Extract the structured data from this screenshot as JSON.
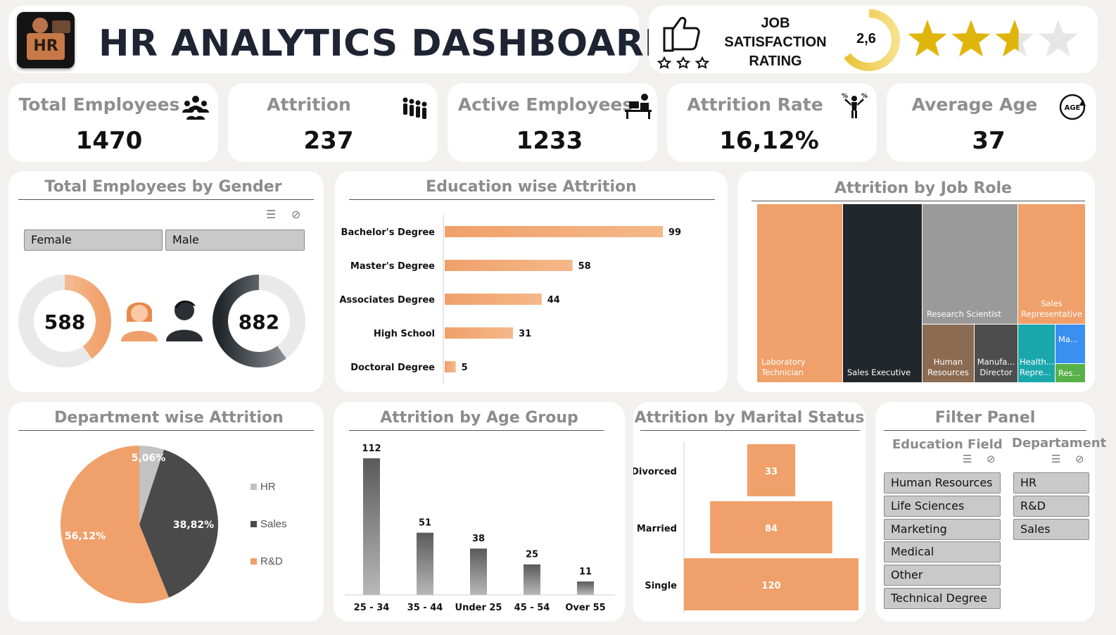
{
  "header": {
    "title": "HR ANALYTICS DASHBOARD",
    "logo_text": "HR"
  },
  "job_satisfaction": {
    "label_lines": [
      "JOB",
      "SATISFACTION",
      "RATING"
    ],
    "value": "2,6",
    "rating": 2.6,
    "max": 4,
    "gauge_fraction": 0.65,
    "star_color": "#e0b50b",
    "empty_star_color": "#e6e6e6"
  },
  "kpis": [
    {
      "label": "Total Employees",
      "value": "1470",
      "icon": "people-group-icon"
    },
    {
      "label": "Attrition",
      "value": "237",
      "icon": "people-leaving-icon"
    },
    {
      "label": "Active Employees",
      "value": "1233",
      "icon": "employee-at-desk-icon"
    },
    {
      "label": "Attrition Rate",
      "value": "16,12%",
      "icon": "percent-person-icon"
    },
    {
      "label": "Average Age",
      "value": "37",
      "icon": "age-cycle-icon"
    }
  ],
  "gender": {
    "title": "Total Employees by Gender",
    "options": [
      "Female",
      "Male"
    ],
    "female_value": "588",
    "male_value": "882",
    "female_fraction": 0.4,
    "male_fraction": 0.6
  },
  "education": {
    "title": "Education wise Attrition",
    "chart_data": {
      "type": "bar",
      "orientation": "horizontal",
      "categories": [
        "Bachelor's Degree",
        "Master's Degree",
        "Associates Degree",
        "High School",
        "Doctoral Degree"
      ],
      "values": [
        99,
        58,
        44,
        31,
        5
      ],
      "title": "Education wise Attrition"
    }
  },
  "job_role": {
    "title": "Attrition by Job Role",
    "tiles": [
      {
        "label": "Laboratory Technician",
        "color": "#f0a06a"
      },
      {
        "label": "Sales Executive",
        "color": "#22272b"
      },
      {
        "label": "Research Scientist",
        "color": "#9a9a9a"
      },
      {
        "label": "Sales Representative",
        "color": "#f0a06a"
      },
      {
        "label": "Human Resources",
        "color": "#8b6b52"
      },
      {
        "label": "Manufa... Director",
        "color": "#4d4d4d"
      },
      {
        "label": "Health... Repre...",
        "color": "#1aa7ac"
      },
      {
        "label": "Ma...",
        "color": "#3a8ff0"
      },
      {
        "label": "Res...",
        "color": "#58b148"
      }
    ]
  },
  "department": {
    "title": "Department wise Attrition",
    "chart_data": {
      "type": "pie",
      "categories": [
        "HR",
        "Sales",
        "R&D"
      ],
      "values": [
        5.06,
        38.82,
        56.12
      ],
      "labels": [
        "5,06%",
        "38,82%",
        "56,12%"
      ],
      "colors": [
        "#c2c2c2",
        "#4a4a4a",
        "#f0a06a"
      ],
      "legend": "right"
    }
  },
  "age_group": {
    "title": "Attrition by Age Group",
    "chart_data": {
      "type": "bar",
      "categories": [
        "25 - 34",
        "35 - 44",
        "Under 25",
        "45 - 54",
        "Over 55"
      ],
      "values": [
        112,
        51,
        38,
        25,
        11
      ],
      "ylim": [
        0,
        120
      ]
    }
  },
  "marital": {
    "title": "Attrition by Marital Status",
    "chart_data": {
      "type": "bar",
      "orientation": "horizontal-funnel",
      "categories": [
        "Divorced",
        "Married",
        "Single"
      ],
      "values": [
        33,
        84,
        120
      ]
    }
  },
  "filter_panel": {
    "title": "Filter Panel",
    "education_field": {
      "title": "Education Field",
      "options": [
        "Human Resources",
        "Life Sciences",
        "Marketing",
        "Medical",
        "Other",
        "Technical Degree"
      ]
    },
    "department": {
      "title": "Departament",
      "options": [
        "HR",
        "R&D",
        "Sales"
      ]
    }
  },
  "colors": {
    "accent": "#f0a06a",
    "dark": "#22272b",
    "gray": "#9a9a9a"
  }
}
